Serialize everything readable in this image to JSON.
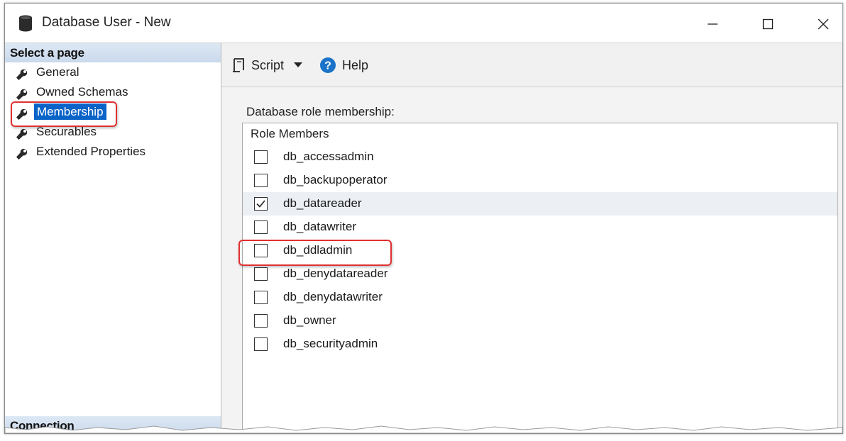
{
  "window": {
    "title": "Database User - New",
    "icon": "database-icon"
  },
  "left": {
    "select_page_header": "Select a page",
    "items": [
      {
        "label": "General",
        "icon": "wrench-icon"
      },
      {
        "label": "Owned Schemas",
        "icon": "wrench-icon"
      },
      {
        "label": "Membership",
        "icon": "wrench-icon",
        "selected": true
      },
      {
        "label": "Securables",
        "icon": "wrench-icon"
      },
      {
        "label": "Extended Properties",
        "icon": "wrench-icon"
      }
    ],
    "connection_header": "Connection"
  },
  "toolbar": {
    "script_label": "Script",
    "help_label": "Help"
  },
  "membership": {
    "label": "Database role membership:",
    "column_header": "Role Members",
    "roles": [
      {
        "name": "db_accessadmin",
        "checked": false
      },
      {
        "name": "db_backupoperator",
        "checked": false
      },
      {
        "name": "db_datareader",
        "checked": true
      },
      {
        "name": "db_datawriter",
        "checked": false
      },
      {
        "name": "db_ddladmin",
        "checked": false
      },
      {
        "name": "db_denydatareader",
        "checked": false
      },
      {
        "name": "db_denydatawriter",
        "checked": false
      },
      {
        "name": "db_owner",
        "checked": false
      },
      {
        "name": "db_securityadmin",
        "checked": false
      }
    ]
  },
  "colors": {
    "selection_blue": "#0a64c8",
    "highlight_red": "#e03030",
    "help_blue": "#1a73c8"
  }
}
